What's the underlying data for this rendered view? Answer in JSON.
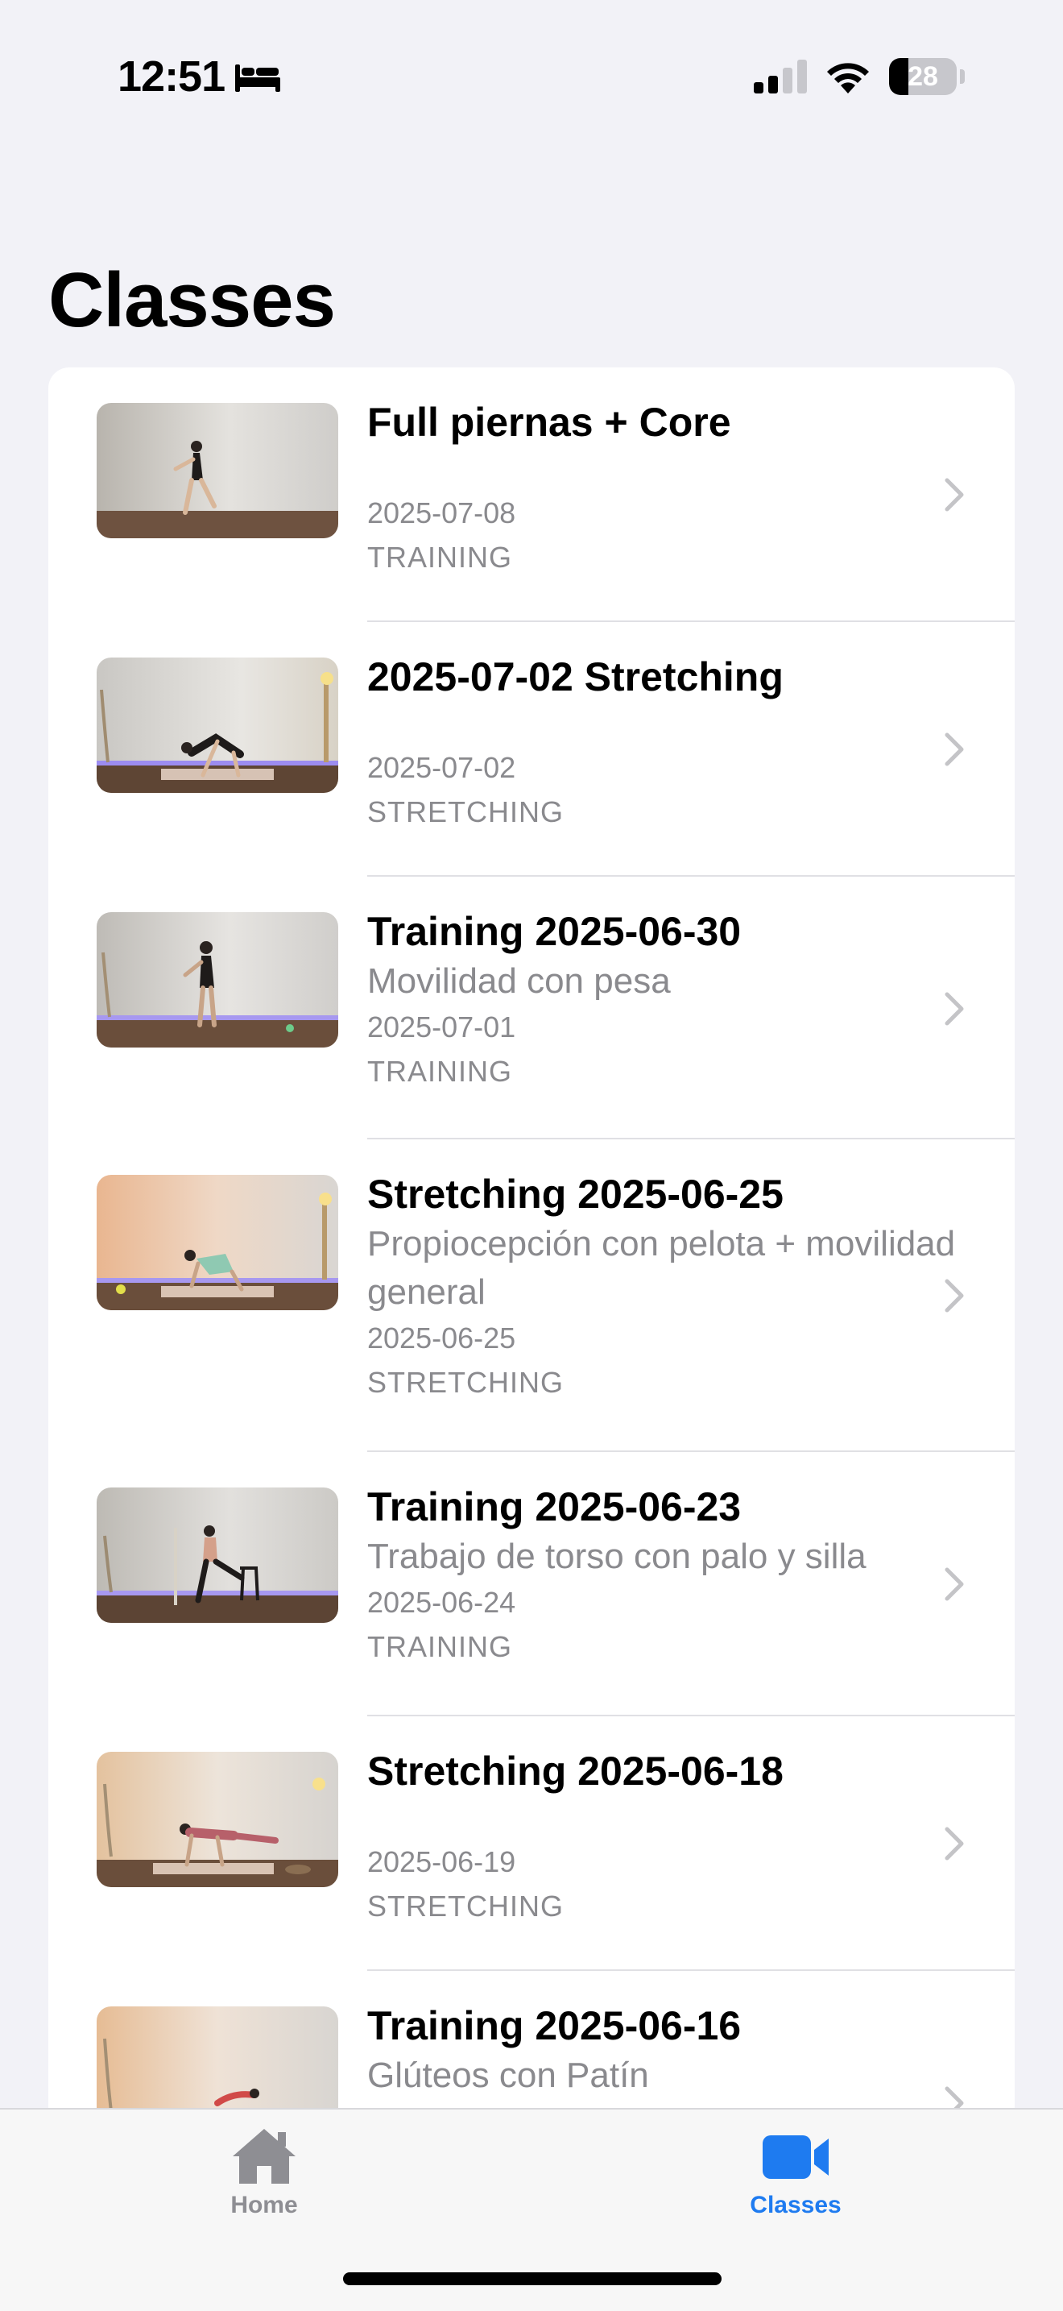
{
  "status_bar": {
    "time": "12:51",
    "focus_icon": "bed-icon",
    "signal_icon": "cellular-signal-icon",
    "wifi_icon": "wifi-icon",
    "battery_level": "28",
    "battery_fraction": 0.28
  },
  "page": {
    "title": "Classes"
  },
  "classes": [
    {
      "title": "Full piernas + Core",
      "subtitle": "",
      "date": "2025-07-08",
      "type": "TRAINING"
    },
    {
      "title": "2025-07-02 Stretching",
      "subtitle": "",
      "date": "2025-07-02",
      "type": "STRETCHING"
    },
    {
      "title": "Training 2025-06-30",
      "subtitle": "Movilidad con pesa",
      "date": "2025-07-01",
      "type": "TRAINING"
    },
    {
      "title": "Stretching 2025-06-25",
      "subtitle": "Propiocepción con pelota + movilidad general",
      "date": "2025-06-25",
      "type": "STRETCHING"
    },
    {
      "title": "Training 2025-06-23",
      "subtitle": "Trabajo de torso con palo y silla",
      "date": "2025-06-24",
      "type": "TRAINING"
    },
    {
      "title": "Stretching 2025-06-18",
      "subtitle": "",
      "date": "2025-06-19",
      "type": "STRETCHING"
    },
    {
      "title": "Training 2025-06-16",
      "subtitle": "Glúteos con Patín",
      "date": "",
      "type": ""
    }
  ],
  "tab_bar": {
    "tabs": [
      {
        "label": "Home",
        "icon": "house-icon",
        "selected": false
      },
      {
        "label": "Classes",
        "icon": "video-camera-icon",
        "selected": true
      }
    ]
  },
  "colors": {
    "accent": "#1E7BF0",
    "tab_inactive": "#8E8E93",
    "background": "#F2F2F7"
  }
}
